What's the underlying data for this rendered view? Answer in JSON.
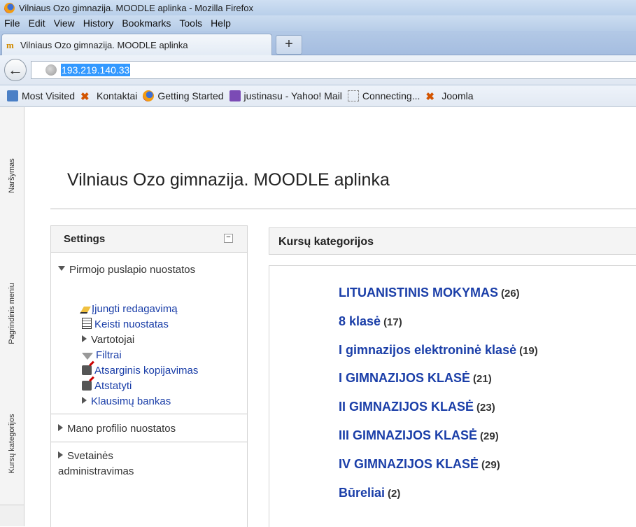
{
  "window": {
    "title": "Vilniaus Ozo gimnazija. MOODLE aplinka - Mozilla Firefox"
  },
  "menu": [
    "File",
    "Edit",
    "View",
    "History",
    "Bookmarks",
    "Tools",
    "Help"
  ],
  "tab": {
    "title": "Vilniaus Ozo gimnazija. MOODLE aplinka",
    "new_tab_label": "+"
  },
  "nav": {
    "back": "←",
    "url": "193.219.140.33"
  },
  "bookmarks": [
    {
      "label": "Most Visited",
      "icon": "most-visited-icon"
    },
    {
      "label": "Kontaktai",
      "icon": "joomla-icon"
    },
    {
      "label": "Getting Started",
      "icon": "firefox-icon"
    },
    {
      "label": "justinasu - Yahoo! Mail",
      "icon": "mail-icon"
    },
    {
      "label": "Connecting...",
      "icon": "loading-icon"
    },
    {
      "label": "Joomla",
      "icon": "joomla-icon"
    }
  ],
  "side_tabs": [
    "Naršymas",
    "Pagrindinis meniu",
    "Kursų kategorijos"
  ],
  "site": {
    "title": "Vilniaus Ozo gimnazija. MOODLE aplinka"
  },
  "settings": {
    "title": "Settings",
    "collapse": "−",
    "front_page_settings": "Pirmojo puslapio nuostatos",
    "turn_editing_on": "Įjungti redagavimą",
    "edit_settings": "Keisti nuostatas",
    "users": "Vartotojai",
    "filters": "Filtrai",
    "backup": "Atsarginis kopijavimas",
    "restore": "Atstatyti",
    "question_bank": "Klausimų bankas",
    "my_profile_settings": "Mano profilio nuostatos",
    "site_admin": "Svetainės administravimas"
  },
  "categories": {
    "title": "Kursų kategorijos",
    "items": [
      {
        "name": "LITUANISTINIS MOKYMAS",
        "count": "(26)"
      },
      {
        "name": "8 klasė",
        "count": "(17)"
      },
      {
        "name": "I gimnazijos elektroninė klasė",
        "count": "(19)"
      },
      {
        "name": "I GIMNAZIJOS KLASĖ",
        "count": "(21)"
      },
      {
        "name": "II GIMNAZIJOS KLASĖ",
        "count": "(23)"
      },
      {
        "name": "III GIMNAZIJOS KLASĖ",
        "count": "(29)"
      },
      {
        "name": "IV GIMNAZIJOS KLASĖ",
        "count": "(29)"
      },
      {
        "name": "Būreliai",
        "count": "(2)"
      }
    ]
  }
}
